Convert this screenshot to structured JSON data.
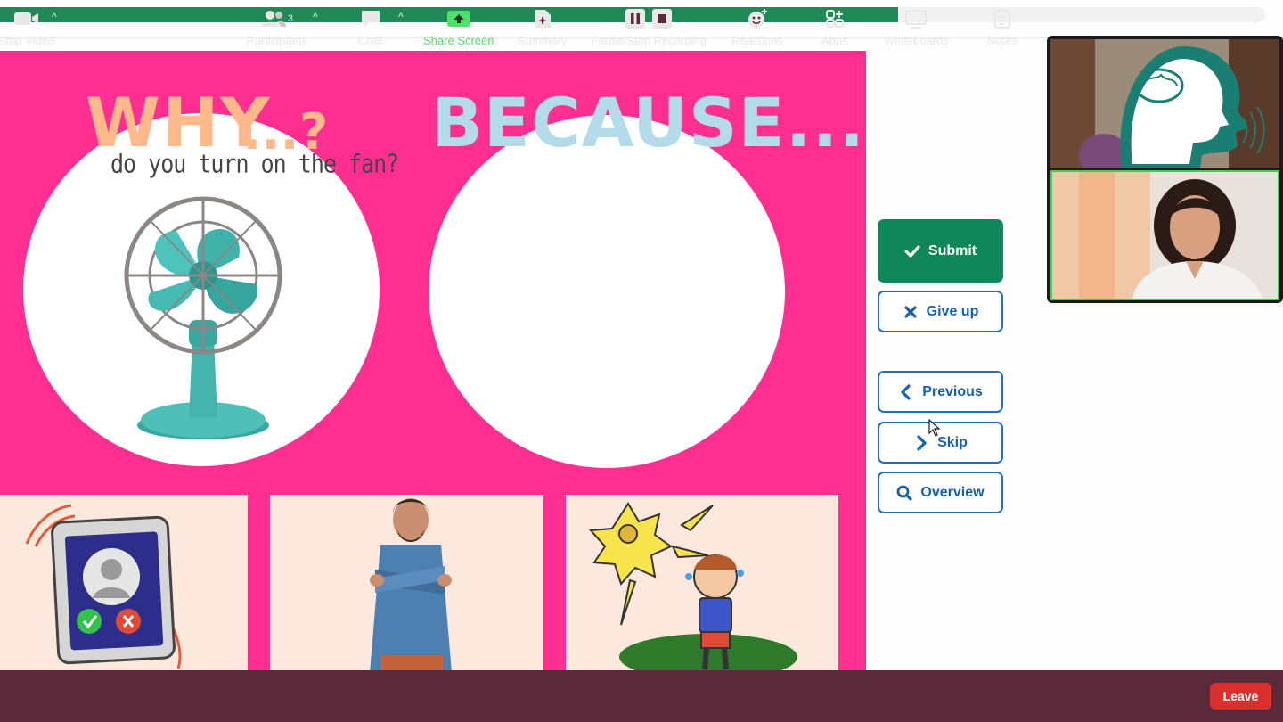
{
  "progress": {
    "value": 0.71,
    "color": "#1f8a57"
  },
  "slide": {
    "why_title": "WHY",
    "why_dots": "...?",
    "question": "do you turn on the fan?",
    "because_title": "BECAUSE...",
    "background": "#ff2f92",
    "option_cards": [
      {
        "name": "phone-call-card",
        "icon": "incoming-call-icon"
      },
      {
        "name": "cold-man-card",
        "icon": "shivering-man-image"
      },
      {
        "name": "hot-sun-card",
        "icon": "sweating-boy-sun-image"
      }
    ]
  },
  "controls": {
    "submit": "Submit",
    "give_up": "Give up",
    "previous": "Previous",
    "skip": "Skip",
    "overview": "Overview",
    "accent": "#10875a",
    "outline": "#1e6fbf"
  },
  "video": {
    "participant_1": "brain-logo-avatar",
    "participant_2": "presenter-video",
    "active_speaker_color": "#3bd14b"
  },
  "toolbar": {
    "stop_video": "Stop Video",
    "participants": "Participants",
    "participants_count": "3",
    "chat": "Chat",
    "share_screen": "Share Screen",
    "summary": "Summary",
    "recording": "Pause/Stop Recording",
    "reactions": "Reactions",
    "apps": "Apps",
    "whiteboards": "Whiteboards",
    "notes": "Notes",
    "leave": "Leave"
  }
}
